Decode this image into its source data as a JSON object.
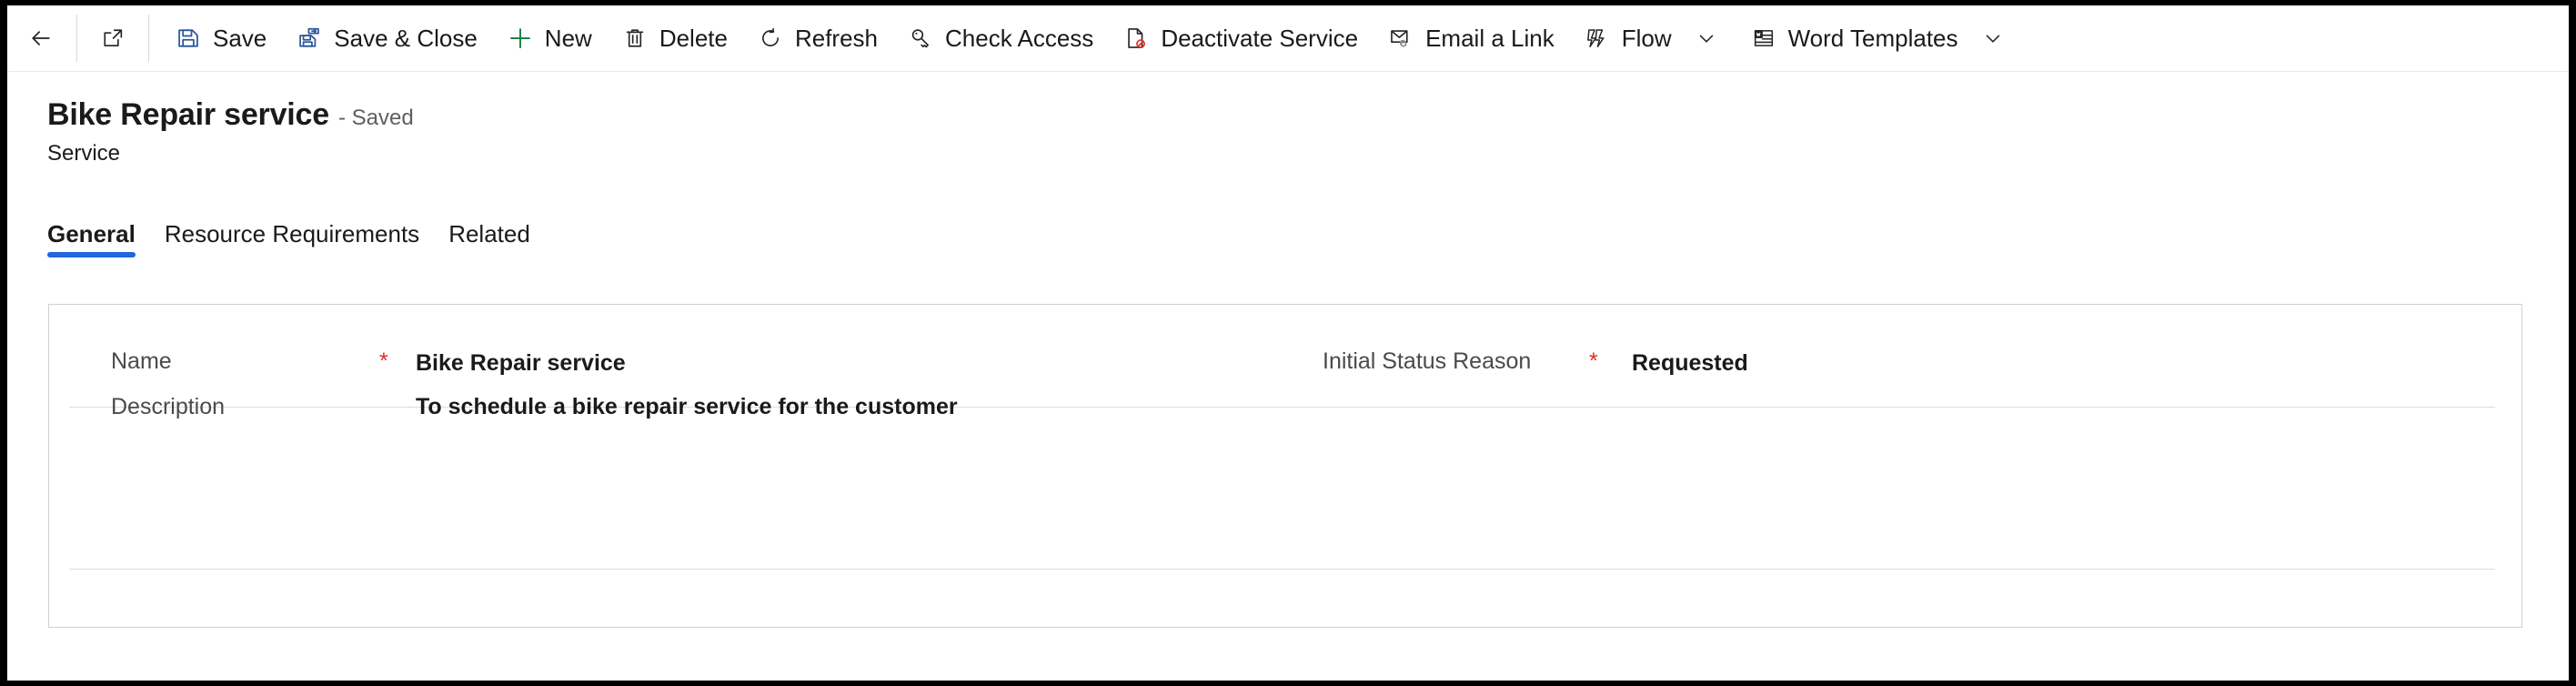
{
  "commandbar": {
    "items": [
      {
        "id": "back",
        "icon": "back-arrow-icon",
        "label": ""
      },
      {
        "id": "popout",
        "icon": "pop-out-icon",
        "label": ""
      },
      {
        "id": "save",
        "icon": "save-icon",
        "label": "Save"
      },
      {
        "id": "save-close",
        "icon": "save-and-close-icon",
        "label": "Save & Close"
      },
      {
        "id": "new",
        "icon": "plus-icon",
        "label": "New"
      },
      {
        "id": "delete",
        "icon": "trash-icon",
        "label": "Delete"
      },
      {
        "id": "refresh",
        "icon": "refresh-icon",
        "label": "Refresh"
      },
      {
        "id": "check-access",
        "icon": "key-icon",
        "label": "Check Access"
      },
      {
        "id": "deactivate",
        "icon": "deactivate-icon",
        "label": "Deactivate Service"
      },
      {
        "id": "email-link",
        "icon": "email-link-icon",
        "label": "Email a Link"
      },
      {
        "id": "flow",
        "icon": "flow-icon",
        "label": "Flow"
      },
      {
        "id": "word-templates",
        "icon": "word-icon",
        "label": "Word Templates"
      }
    ]
  },
  "header": {
    "title": "Bike Repair service",
    "state": "- Saved",
    "entity": "Service"
  },
  "tabs": [
    {
      "label": "General",
      "active": true
    },
    {
      "label": "Resource Requirements",
      "active": false
    },
    {
      "label": "Related",
      "active": false
    }
  ],
  "form": {
    "fields": {
      "name": {
        "label": "Name",
        "required_marker": "*",
        "value": "Bike Repair service"
      },
      "description": {
        "label": "Description",
        "value": "To schedule a bike repair service for the customer"
      },
      "initial_status_reason": {
        "label": "Initial Status Reason",
        "required_marker": "*",
        "value": "Requested"
      }
    }
  },
  "colors": {
    "accent": "#2266dd",
    "required": "#d93025",
    "text": "#1b1a19",
    "label": "#4a4a4a",
    "save_icon": "#2b579a",
    "new_icon": "#107c41",
    "deactivate_badge": "#d93025"
  }
}
